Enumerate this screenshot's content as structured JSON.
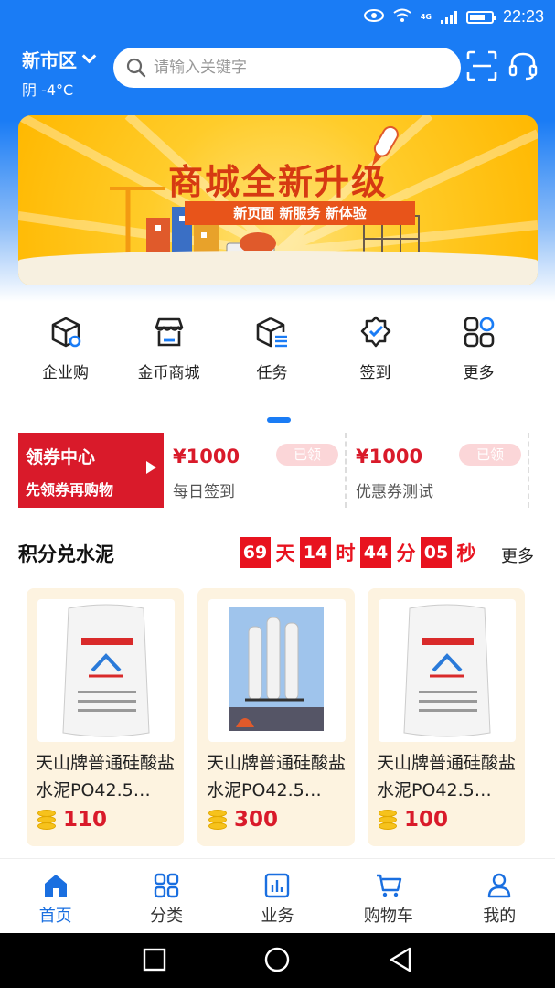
{
  "status_bar": {
    "time": "22:23",
    "network": "4G"
  },
  "header": {
    "city": "新市区",
    "weather": "阴 -4°C",
    "search_placeholder": "请输入关键字"
  },
  "banner": {
    "title": "商城全新升级",
    "subtitle": "新页面 新服务 新体验"
  },
  "menu": [
    {
      "label": "企业购",
      "icon": "box-icon"
    },
    {
      "label": "金币商城",
      "icon": "store-icon"
    },
    {
      "label": "任务",
      "icon": "task-box-icon"
    },
    {
      "label": "签到",
      "icon": "badge-check-icon"
    },
    {
      "label": "更多",
      "icon": "grid-more-icon"
    }
  ],
  "coupon_center": {
    "title": "领券中心",
    "subtitle": "先领券再购物"
  },
  "coupons": [
    {
      "price": "¥1000",
      "desc": "每日签到",
      "status": "已领"
    },
    {
      "price": "¥1000",
      "desc": "优惠券测试",
      "status": "已领"
    }
  ],
  "section": {
    "title": "积分兑水泥",
    "countdown": {
      "days": "69",
      "days_unit": "天",
      "hours": "14",
      "hours_unit": "时",
      "minutes": "44",
      "minutes_unit": "分",
      "seconds": "05",
      "seconds_unit": "秒"
    },
    "more": "更多"
  },
  "products": [
    {
      "name": "天山牌普通硅酸盐水泥PO42.5…",
      "points": "110"
    },
    {
      "name": "天山牌普通硅酸盐水泥PO42.5…",
      "points": "300"
    },
    {
      "name": "天山牌普通硅酸盐水泥PO42.5…",
      "points": "100"
    }
  ],
  "tabbar": [
    {
      "label": "首页",
      "icon": "home-icon",
      "active": true
    },
    {
      "label": "分类",
      "icon": "category-icon",
      "active": false
    },
    {
      "label": "业务",
      "icon": "business-icon",
      "active": false
    },
    {
      "label": "购物车",
      "icon": "cart-icon",
      "active": false
    },
    {
      "label": "我的",
      "icon": "user-icon",
      "active": false
    }
  ],
  "colors": {
    "primary": "#1a7cf5",
    "accent_red": "#d91a2a",
    "banner_yellow": "#ffcc2a"
  }
}
